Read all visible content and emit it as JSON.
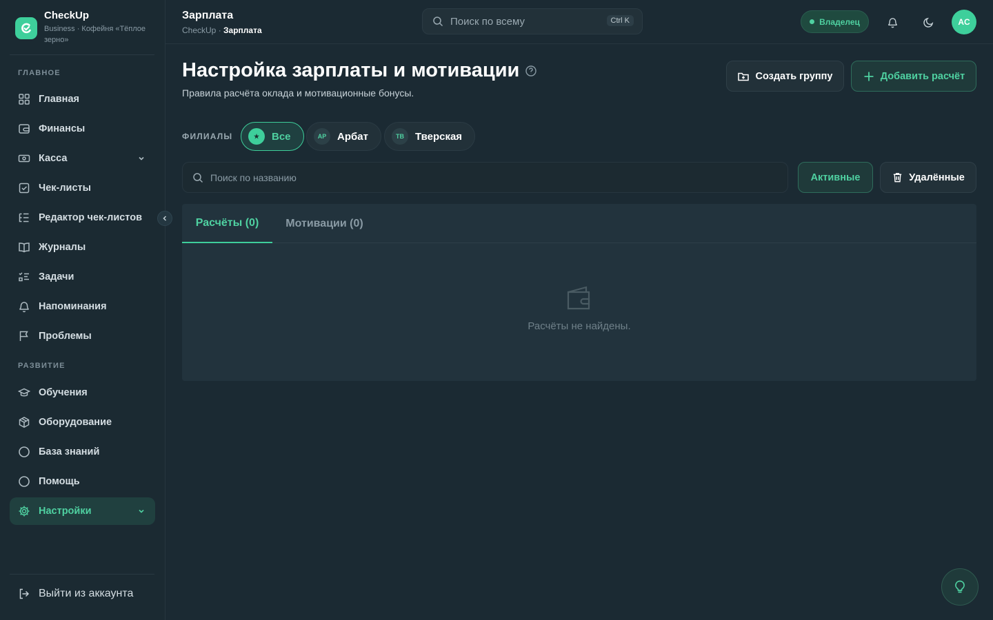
{
  "brand": {
    "name": "CheckUp",
    "subtitle": "Business · Кофейня «Тёплое зерно»"
  },
  "sidebar": {
    "sections": [
      "ГЛАВНОЕ",
      "РАЗВИТИЕ"
    ],
    "items": [
      {
        "label": "Главная",
        "icon": "dashboard-icon"
      },
      {
        "label": "Финансы",
        "icon": "wallet-icon"
      },
      {
        "label": "Касса",
        "icon": "cash-icon"
      },
      {
        "label": "Чек-листы",
        "icon": "checklist-icon"
      },
      {
        "label": "Редактор чек-листов",
        "icon": "list-tree-icon"
      },
      {
        "label": "Журналы",
        "icon": "book-icon"
      },
      {
        "label": "Задачи",
        "icon": "tasks-icon"
      },
      {
        "label": "Напоминания",
        "icon": "bell-icon"
      },
      {
        "label": "Проблемы",
        "icon": "flag-icon"
      },
      {
        "label": "Обучения",
        "icon": "graduation-cap-icon"
      },
      {
        "label": "Оборудование",
        "icon": "box-icon"
      },
      {
        "label": "База знаний",
        "icon": "circle-icon"
      },
      {
        "label": "Помощь",
        "icon": "circle-icon"
      },
      {
        "label": "Настройки",
        "icon": "gear-icon"
      }
    ],
    "logout": "Выйти из аккаунта"
  },
  "topbar": {
    "title": "Зарплата",
    "breadcrumb_root": "CheckUp ·",
    "breadcrumb_current": "Зарплата",
    "search_placeholder": "Поиск по всему",
    "search_shortcut": "Ctrl K",
    "role": "Владелец",
    "avatar_initials": "AC"
  },
  "page": {
    "title": "Настройка зарплаты и мотивации",
    "subtitle": "Правила расчёта оклада и мотивационные бонусы.",
    "create_group": "Создать группу",
    "add_calc": "Добавить расчёт"
  },
  "filials": {
    "label": "ФИЛИАЛЫ",
    "chips": [
      {
        "badge": "★",
        "label": "Все",
        "active": true
      },
      {
        "badge": "АР",
        "label": "Арбат",
        "active": false
      },
      {
        "badge": "ТВ",
        "label": "Тверская",
        "active": false
      }
    ]
  },
  "filters": {
    "search_placeholder": "Поиск по названию",
    "active": "Активные",
    "deleted": "Удалённые"
  },
  "tabs": [
    {
      "label": "Расчёты (0)",
      "active": true
    },
    {
      "label": "Мотивации (0)",
      "active": false
    }
  ],
  "empty_state": "Расчёты не найдены.",
  "colors": {
    "accent": "#3ecf9b",
    "background": "#1b2a33",
    "panel": "#22333d"
  }
}
